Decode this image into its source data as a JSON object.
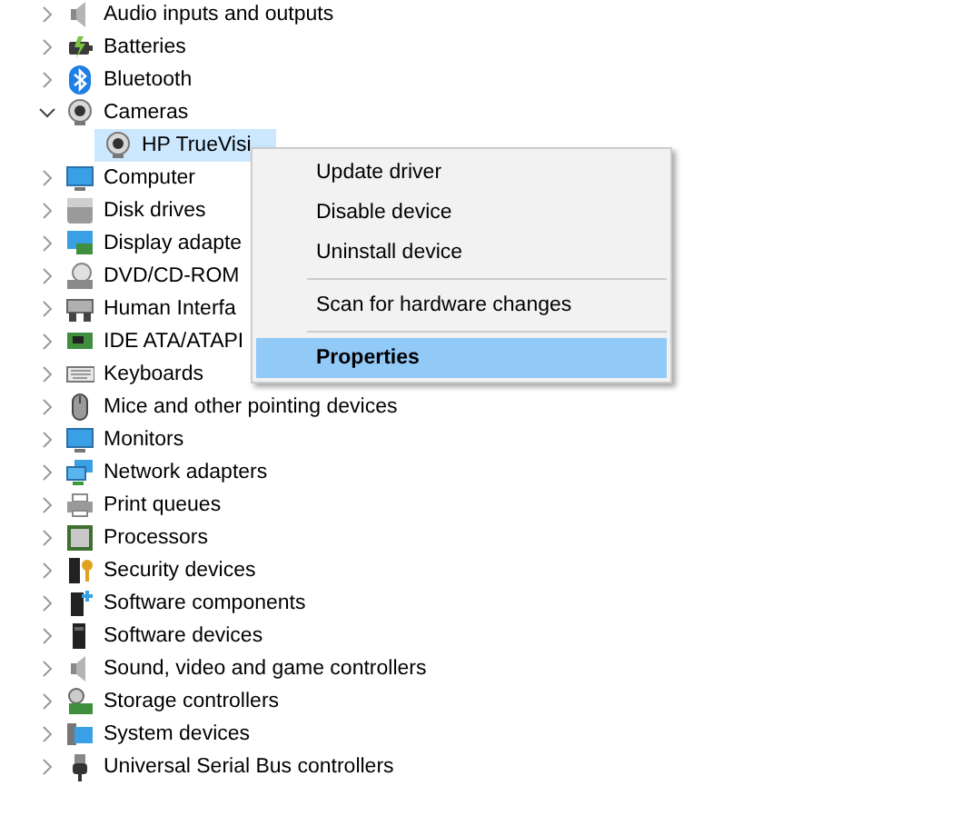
{
  "tree": [
    {
      "label": "Audio inputs and outputs",
      "expanded": false
    },
    {
      "label": "Batteries",
      "expanded": false
    },
    {
      "label": "Bluetooth",
      "expanded": false
    },
    {
      "label": "Cameras",
      "expanded": true,
      "children": [
        {
          "label": "HP TrueVisi",
          "selected": true
        }
      ]
    },
    {
      "label": "Computer",
      "expanded": false
    },
    {
      "label": "Disk drives",
      "expanded": false
    },
    {
      "label": "Display adapte",
      "expanded": false
    },
    {
      "label": "DVD/CD-ROM",
      "expanded": false
    },
    {
      "label": "Human Interfa",
      "expanded": false
    },
    {
      "label": "IDE ATA/ATAPI",
      "expanded": false
    },
    {
      "label": "Keyboards",
      "expanded": false
    },
    {
      "label": "Mice and other pointing devices",
      "expanded": false
    },
    {
      "label": "Monitors",
      "expanded": false
    },
    {
      "label": "Network adapters",
      "expanded": false
    },
    {
      "label": "Print queues",
      "expanded": false
    },
    {
      "label": "Processors",
      "expanded": false
    },
    {
      "label": "Security devices",
      "expanded": false
    },
    {
      "label": "Software components",
      "expanded": false
    },
    {
      "label": "Software devices",
      "expanded": false
    },
    {
      "label": "Sound, video and game controllers",
      "expanded": false
    },
    {
      "label": "Storage controllers",
      "expanded": false
    },
    {
      "label": "System devices",
      "expanded": false
    },
    {
      "label": "Universal Serial Bus controllers",
      "expanded": false
    }
  ],
  "context_menu": {
    "groups": [
      [
        {
          "label": "Update driver",
          "selected": false,
          "default": false
        },
        {
          "label": "Disable device",
          "selected": false,
          "default": false
        },
        {
          "label": "Uninstall device",
          "selected": false,
          "default": false
        }
      ],
      [
        {
          "label": "Scan for hardware changes",
          "selected": false,
          "default": false
        }
      ],
      [
        {
          "label": "Properties",
          "selected": true,
          "default": true
        }
      ]
    ]
  }
}
